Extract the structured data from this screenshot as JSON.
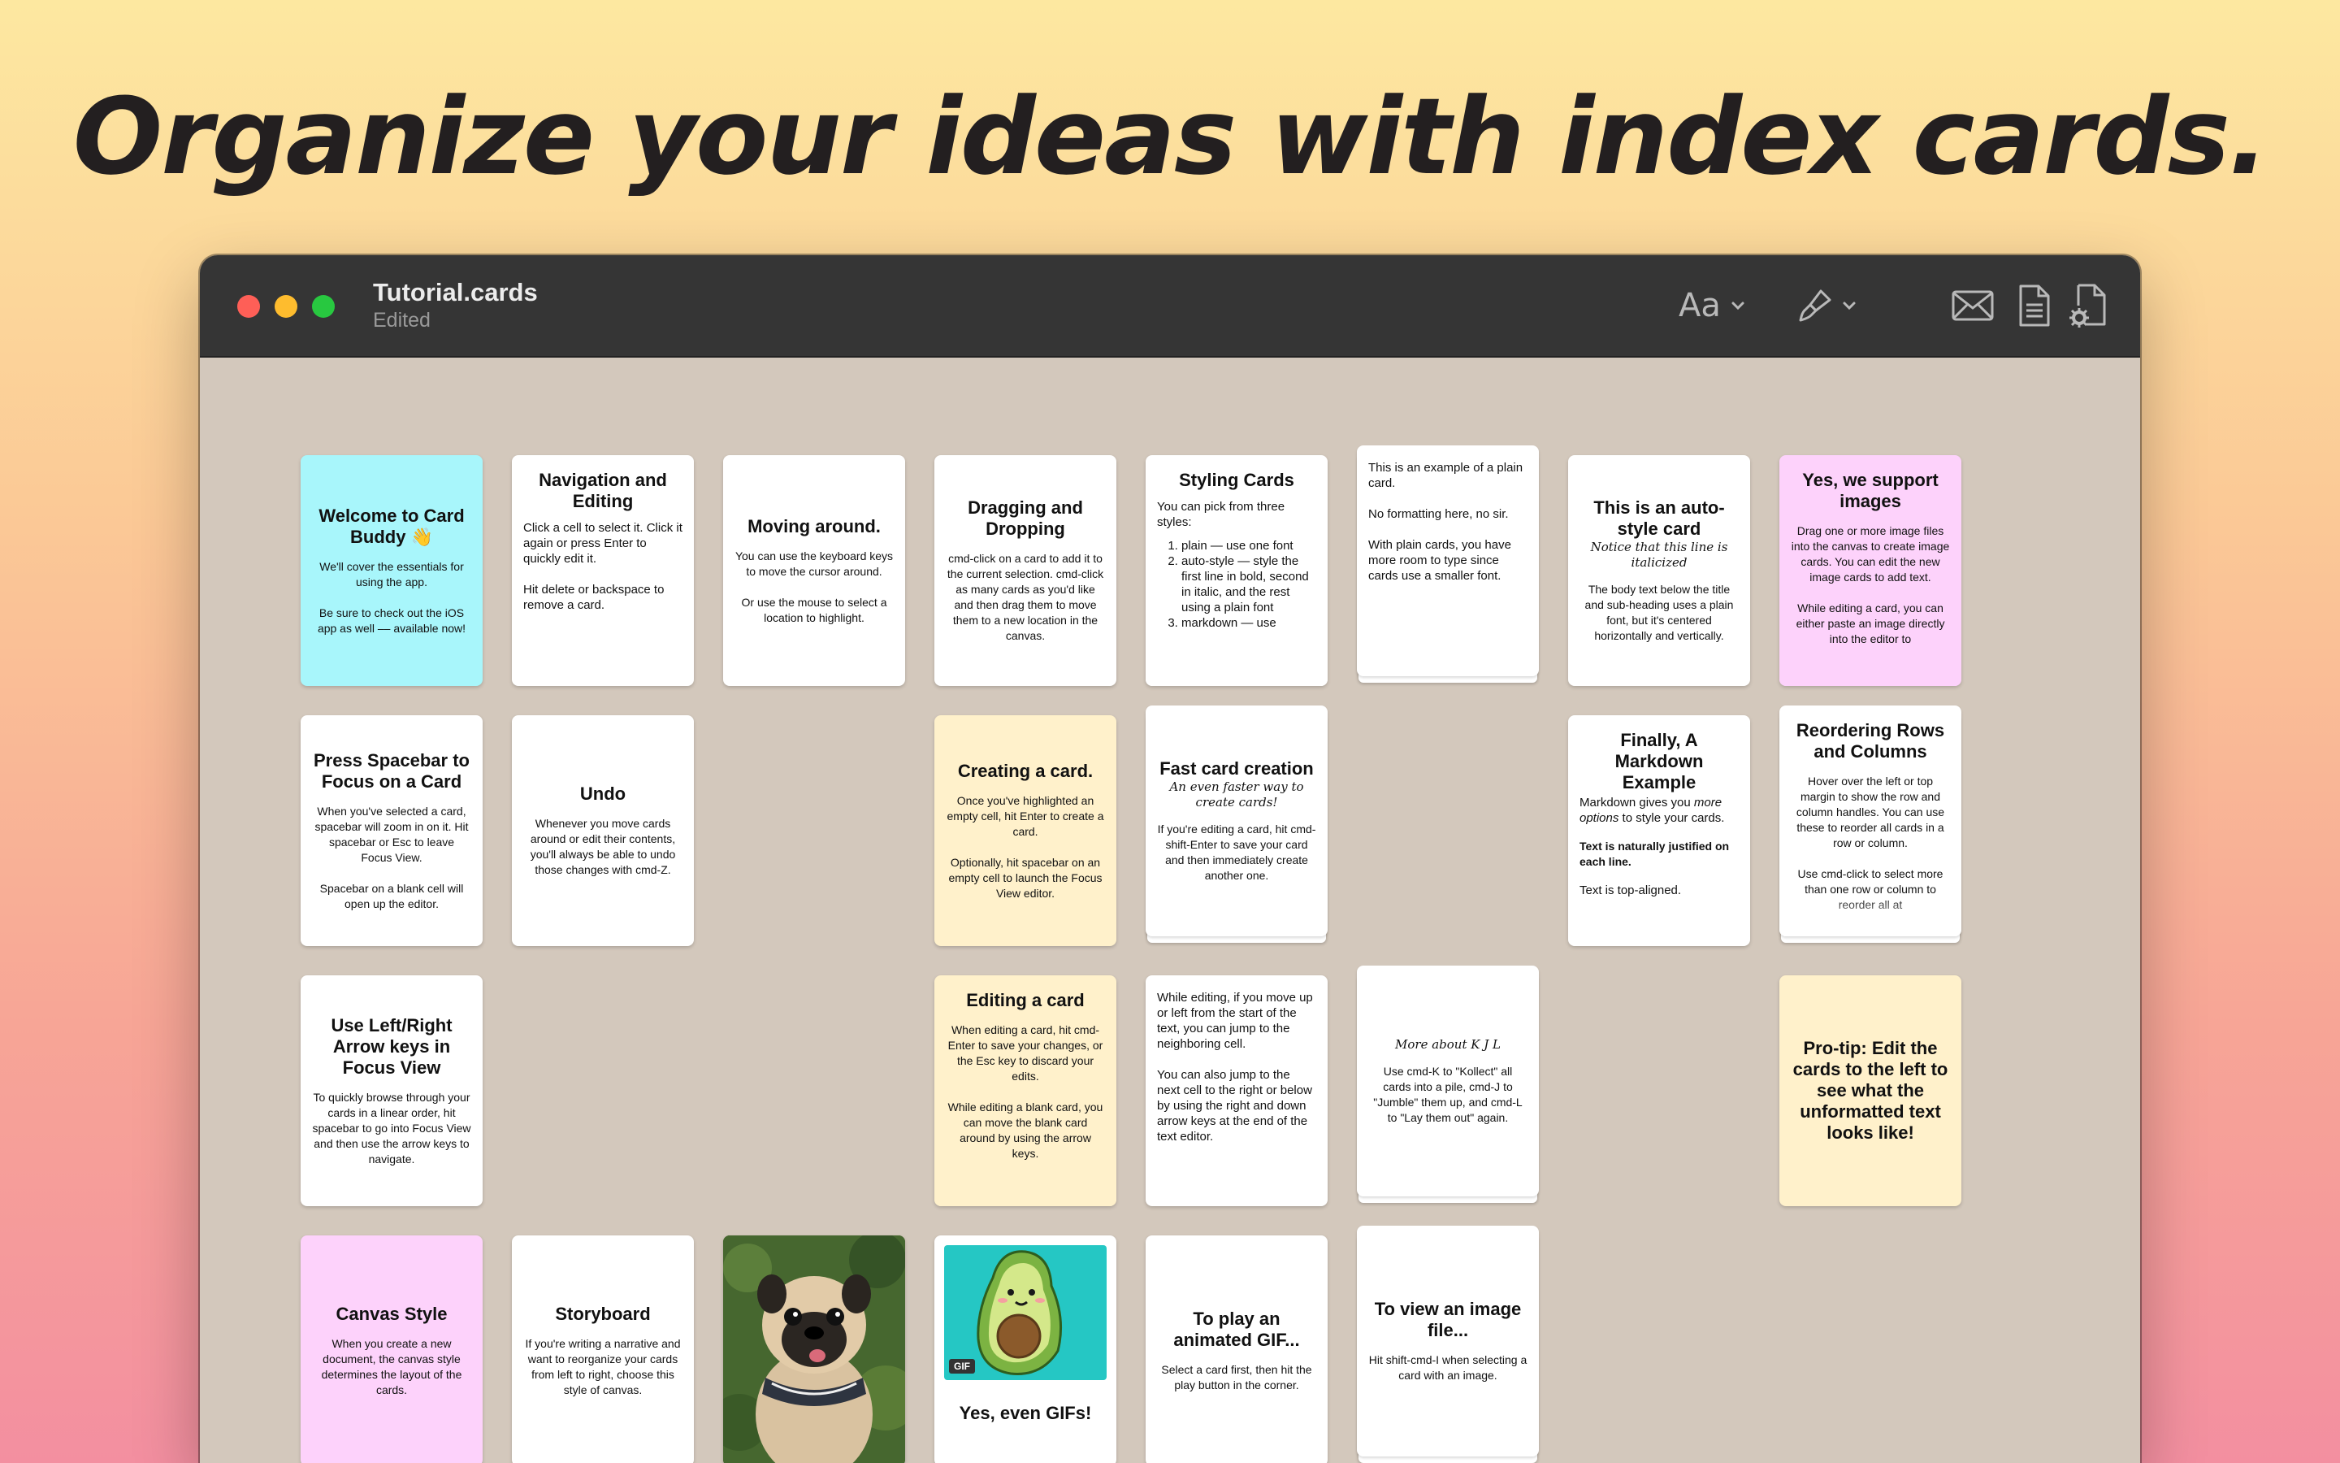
{
  "headline": "Organize your ideas with index cards.",
  "window": {
    "title": "Tutorial.cards",
    "subtitle": "Edited",
    "toolbar": {
      "font_label": "Aa",
      "icons": [
        "font-menu-icon",
        "paintbrush-icon",
        "mail-icon",
        "document-icon",
        "document-settings-icon"
      ]
    }
  },
  "colors": {
    "cyan": "#a8f6fb",
    "pink": "#fdd2fb",
    "yellow": "#fff1cb",
    "canvas": "#d3c8bc"
  },
  "cards": {
    "welcome": {
      "title": "Welcome to Card Buddy 👋",
      "body": "We'll cover the essentials for using the app.\n\nBe sure to check out the iOS app as well –– available now!"
    },
    "navigation": {
      "title": "Navigation and Editing",
      "body": "Click a cell to select it. Click it again or press Enter to quickly edit it.\n\nHit delete or backspace to remove a card."
    },
    "moving": {
      "title": "Moving around.",
      "body": "You can use the keyboard keys to move the cursor around.\n\nOr use the mouse to select a location to highlight."
    },
    "dragging": {
      "title": "Dragging and Dropping",
      "body": "cmd-click on a card to add it to the current selection. cmd-click as many cards as you'd like and then drag them to move them to a new location in the canvas."
    },
    "styling": {
      "title": "Styling Cards",
      "intro": "You can pick from three styles:",
      "items": [
        "plain — use one font",
        "auto-style — style the first line in bold, second in italic, and the rest using a plain font",
        "markdown — use"
      ]
    },
    "plain": {
      "body": "This is an example of a plain card.\n\nNo formatting here, no sir.\n\nWith plain cards, you have more room to type since cards use a smaller font."
    },
    "autostyle": {
      "title": "This is an auto-style card",
      "subtitle": "Notice that this line is italicized",
      "body": "The body text below the title and sub-heading uses a plain font, but it's centered horizontally and vertically."
    },
    "images": {
      "title": "Yes, we support images",
      "body": "Drag one or more image files into the canvas to create image cards. You can edit the new image cards to add text.\n\nWhile editing a card, you can either paste an image directly into the editor to"
    },
    "spacebar": {
      "title": "Press Spacebar to Focus on a Card",
      "body": "When you've selected a card, spacebar will zoom in on it. Hit spacebar or Esc to leave Focus View.\n\nSpacebar on a blank cell will open up the editor."
    },
    "undo": {
      "title": "Undo",
      "body": "Whenever you move cards around or edit their contents, you'll always be able to undo those changes with cmd-Z."
    },
    "creating": {
      "title": "Creating a card.",
      "body": "Once you've highlighted an empty cell, hit Enter to create a card.\n\nOptionally, hit spacebar on an empty cell to launch the Focus View editor."
    },
    "fast": {
      "title": "Fast card creation",
      "subtitle": "An even faster way to create cards!",
      "body": "If you're editing a card, hit cmd-shift-Enter to save your card and then immediately create another one."
    },
    "markdown": {
      "title": "Finally, A Markdown Example",
      "body_pre": "Markdown gives you ",
      "body_em": "more options",
      "body_post": " to style your cards.",
      "bold": "Text is naturally justified on each line.",
      "last": "Text is top-aligned."
    },
    "reorder": {
      "title": "Reordering Rows and Columns",
      "body": "Hover over the left or top margin to show the row and column handles. You can use these to reorder all cards in a row or column.\n\nUse cmd-click to select more than one row or column to reorder all at"
    },
    "arrows": {
      "title": "Use Left/Right Arrow keys in Focus View",
      "body": "To quickly browse through your cards in a linear order, hit spacebar to go into Focus View and then use the arrow keys to navigate."
    },
    "editing": {
      "title": "Editing a card",
      "body": "When editing a card, hit cmd-Enter to save your changes, or the Esc key to discard your edits.\n\nWhile editing a blank card, you can move the blank card around by using the arrow keys."
    },
    "jump": {
      "body": "While editing, if you move up or left from the start of the text, you can jump to the neighboring cell.\n\nYou can also jump to the next cell to the right or below by using the right and down arrow keys at the end of the text editor."
    },
    "kjl": {
      "subtitle": "More about K J L",
      "body": "Use cmd-K to \"Kollect\" all cards into a pile, cmd-J to \"Jumble\" them up, and cmd-L to \"Lay them out\" again."
    },
    "protip": {
      "title": "Pro-tip: Edit the cards to the left to see what the unformatted text looks like!"
    },
    "canvas_style": {
      "title": "Canvas Style",
      "body": "When you create a new document, the canvas style determines the layout of the cards."
    },
    "storyboard": {
      "title": "Storyboard",
      "body": "If you're writing a narrative and want to reorganize your cards from left to right, choose this style of canvas."
    },
    "gif": {
      "badge": "GIF",
      "title": "Yes, even GIFs!"
    },
    "play_gif": {
      "title": "To play an animated GIF...",
      "body": "Select a card first, then hit the play button in the corner."
    },
    "view_image": {
      "title": "To view an image file...",
      "body": "Hit shift-cmd-I when selecting a card with an image."
    }
  }
}
